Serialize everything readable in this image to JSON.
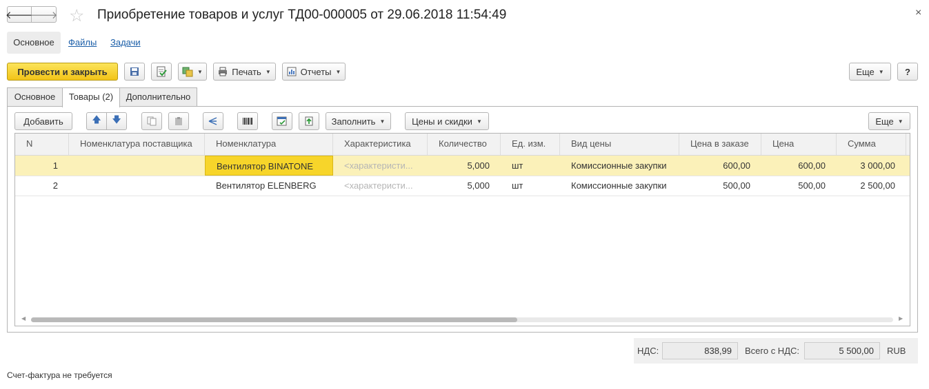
{
  "window": {
    "title": "Приобретение товаров и услуг ТД00-000005 от 29.06.2018 11:54:49",
    "back_glyph": "🡐",
    "forward_glyph": "🡒",
    "star_glyph": "☆",
    "close_glyph": "×"
  },
  "form_tabs": [
    "Основное",
    "Файлы",
    "Задачи"
  ],
  "command_bar": {
    "post_close": "Провести и закрыть",
    "print": "Печать",
    "reports": "Отчеты",
    "more": "Еще",
    "help": "?"
  },
  "page_tabs": [
    "Основное",
    "Товары (2)",
    "Дополнительно"
  ],
  "table_toolbar": {
    "add": "Добавить",
    "fill": "Заполнить",
    "prices": "Цены и скидки",
    "more": "Еще"
  },
  "table": {
    "columns": [
      "N",
      "Номенклатура поставщика",
      "Номенклатура",
      "Характеристика",
      "Количество",
      "Ед. изм.",
      "Вид цены",
      "Цена в заказе",
      "Цена",
      "Сумма"
    ],
    "rows": [
      {
        "n": "1",
        "supplier_item": "",
        "item": "Вентилятор BINATONE",
        "characteristic": "<характеристи...",
        "qty": "5,000",
        "unit": "шт",
        "price_type": "Комиссионные закупки",
        "order_price": "600,00",
        "price": "600,00",
        "sum": "3 000,00"
      },
      {
        "n": "2",
        "supplier_item": "",
        "item": "Вентилятор ELENBERG",
        "characteristic": "<характеристи...",
        "qty": "5,000",
        "unit": "шт",
        "price_type": "Комиссионные закупки",
        "order_price": "500,00",
        "price": "500,00",
        "sum": "2 500,00"
      }
    ]
  },
  "totals": {
    "vat_label": "НДС:",
    "vat_value": "838,99",
    "total_label": "Всего с НДС:",
    "total_value": "5 500,00",
    "currency": "RUB"
  },
  "footer_text": "Счет-фактура не требуется"
}
